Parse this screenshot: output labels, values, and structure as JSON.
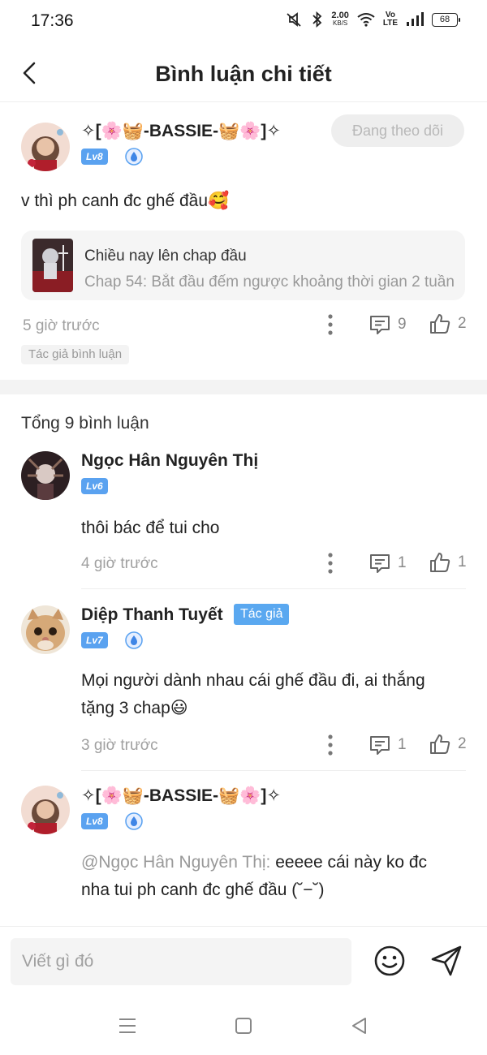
{
  "status_bar": {
    "time": "17:36",
    "net_speed_value": "2.00",
    "net_speed_unit": "KB/S",
    "volte_top": "Vo",
    "volte_bottom": "LTE",
    "battery": "68"
  },
  "header": {
    "title": "Bình luận chi tiết"
  },
  "main_comment": {
    "user_name": "✧[🌸🧺-BASSIE-🧺🌸]✧",
    "level": "Lv8",
    "follow_label": "Đang theo dõi",
    "text": "v thì ph canh đc ghế đầu🥰",
    "chapter": {
      "title": "Chiều nay lên chap đầu",
      "subtitle": "Chap 54: Bắt đầu đếm ngược khoảng thời gian 2 tuần"
    },
    "time": "5 giờ trước",
    "reply_count": "9",
    "like_count": "2",
    "author_tag": "Tác giả bình luận"
  },
  "total_label": "Tổng 9 bình luận",
  "replies": [
    {
      "user_name": "Ngọc Hân Nguyên Thị",
      "level": "Lv6",
      "text": "thôi bác để tui cho",
      "time": "4 giờ trước",
      "reply_count": "1",
      "like_count": "1"
    },
    {
      "user_name": "Diệp Thanh Tuyết",
      "author_chip": "Tác giả",
      "level": "Lv7",
      "text_line1": "Mọi người dành nhau cái ghế đầu đi, ai thắng",
      "text_line2": "tặng 3 chap😃",
      "time": "3 giờ trước",
      "reply_count": "1",
      "like_count": "2"
    },
    {
      "user_name": "✧[🌸🧺-BASSIE-🧺🌸]✧",
      "level": "Lv8",
      "mention": "@Ngọc Hân Nguyên Thị:",
      "text_line1": " eeeee cái này ko đc",
      "text_line2": "nha tui ph canh đc ghế đầu (˘−˘)"
    }
  ],
  "input": {
    "placeholder": "Viết gì đó"
  },
  "colors": {
    "accent_blue": "#5aa2f0",
    "text_gray": "#a0a0a0"
  }
}
